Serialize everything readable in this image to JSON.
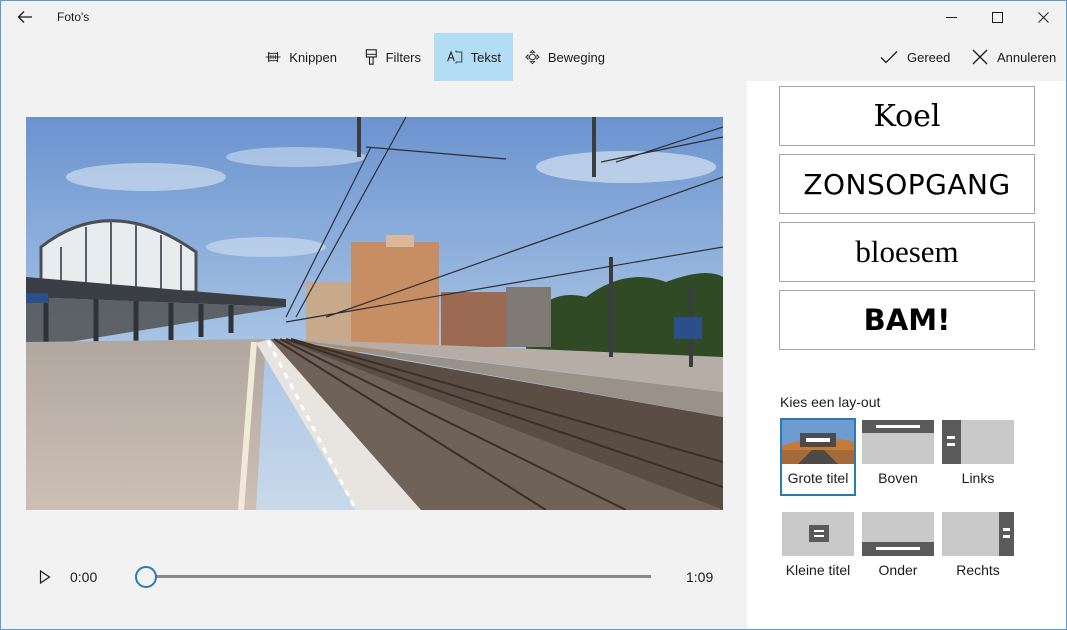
{
  "window": {
    "title": "Foto's"
  },
  "toolbar": {
    "items": [
      {
        "label": "Knippen",
        "icon": "trim-icon",
        "active": false
      },
      {
        "label": "Filters",
        "icon": "filter-brush-icon",
        "active": false
      },
      {
        "label": "Tekst",
        "icon": "text-icon",
        "active": true
      },
      {
        "label": "Beweging",
        "icon": "motion-icon",
        "active": false
      }
    ],
    "done_label": "Gereed",
    "cancel_label": "Annuleren"
  },
  "player": {
    "current_time": "0:00",
    "total_time": "1:09",
    "progress": 0.0
  },
  "text_styles": [
    "Koel",
    "ZONSOPGANG",
    "bloesem",
    "BAM!"
  ],
  "layouts": {
    "heading": "Kies een lay-out",
    "options": [
      {
        "label": "Grote titel",
        "selected": true
      },
      {
        "label": "Boven",
        "selected": false
      },
      {
        "label": "Links",
        "selected": false
      },
      {
        "label": "Kleine titel",
        "selected": false
      },
      {
        "label": "Onder",
        "selected": false
      },
      {
        "label": "Rechts",
        "selected": false
      }
    ]
  },
  "colors": {
    "accent": "#2a7ab8",
    "active_tool": "#b3dcf5",
    "background": "#f2f2f2",
    "panel": "#ffffff"
  }
}
